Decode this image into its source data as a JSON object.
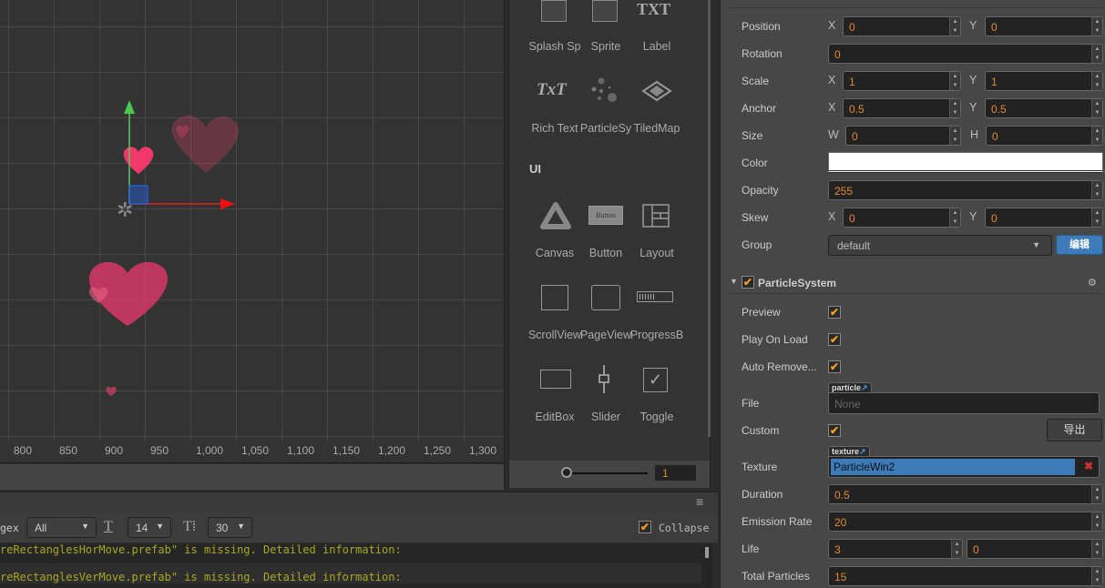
{
  "scene": {
    "ruler_ticks": [
      "800",
      "850",
      "900",
      "950",
      "1,000",
      "1,050",
      "1,100",
      "1,150",
      "1,200",
      "1,250",
      "1,300"
    ]
  },
  "widgets": {
    "row1": [
      "Splash Sp",
      "Sprite",
      "Label"
    ],
    "row2": [
      "Rich Text",
      "ParticleSy",
      "TiledMap"
    ],
    "ui_heading": "UI",
    "row3": [
      "Canvas",
      "Button",
      "Layout"
    ],
    "row4": [
      "ScrollView",
      "PageView",
      "ProgressB"
    ],
    "row5": [
      "EditBox",
      "Slider",
      "Toggle"
    ],
    "button_icon_text": "Button",
    "label_icon_text": "TXT",
    "richtext_icon_text": "TxT",
    "zoom_value": "1"
  },
  "console": {
    "filter_label": "gex",
    "level": "All",
    "font_size": "14",
    "line_height": "30",
    "collapse_label": "Collapse",
    "collapse_checked": true,
    "lines": [
      "reRectanglesHorMove.prefab\" is missing. Detailed information:",
      "reRectanglesVerMove.prefab\" is missing. Detailed information:"
    ]
  },
  "inspector": {
    "node": {
      "position": {
        "label": "Position",
        "x": "0",
        "y": "0"
      },
      "rotation": {
        "label": "Rotation",
        "value": "0"
      },
      "scale": {
        "label": "Scale",
        "x": "1",
        "y": "1"
      },
      "anchor": {
        "label": "Anchor",
        "x": "0.5",
        "y": "0.5"
      },
      "size": {
        "label": "Size",
        "w": "0",
        "h": "0"
      },
      "color": {
        "label": "Color",
        "value": "#ffffff"
      },
      "opacity": {
        "label": "Opacity",
        "value": "255"
      },
      "skew": {
        "label": "Skew",
        "x": "0",
        "y": "0"
      },
      "group": {
        "label": "Group",
        "value": "default",
        "edit_button": "编辑"
      }
    },
    "axis": {
      "x": "X",
      "y": "Y",
      "w": "W",
      "h": "H"
    },
    "particle": {
      "title": "ParticleSystem",
      "enabled": true,
      "preview": {
        "label": "Preview",
        "checked": true
      },
      "play_on_load": {
        "label": "Play On Load",
        "checked": true
      },
      "auto_remove": {
        "label": "Auto Remove...",
        "checked": true
      },
      "file": {
        "label": "File",
        "tag": "particle",
        "value": "None"
      },
      "custom": {
        "label": "Custom",
        "checked": true,
        "export_button": "导出"
      },
      "texture": {
        "label": "Texture",
        "tag": "texture",
        "value": "ParticleWin2"
      },
      "duration": {
        "label": "Duration",
        "value": "0.5"
      },
      "emission_rate": {
        "label": "Emission Rate",
        "value": "20"
      },
      "life": {
        "label": "Life",
        "value": "3",
        "variance": "0"
      },
      "total_particles": {
        "label": "Total Particles",
        "value": "15"
      }
    }
  },
  "colors": {
    "accent": "#f39c1f",
    "value_text": "#e08a2a",
    "selection": "#3d7ab8",
    "heart": "#f0386b"
  }
}
